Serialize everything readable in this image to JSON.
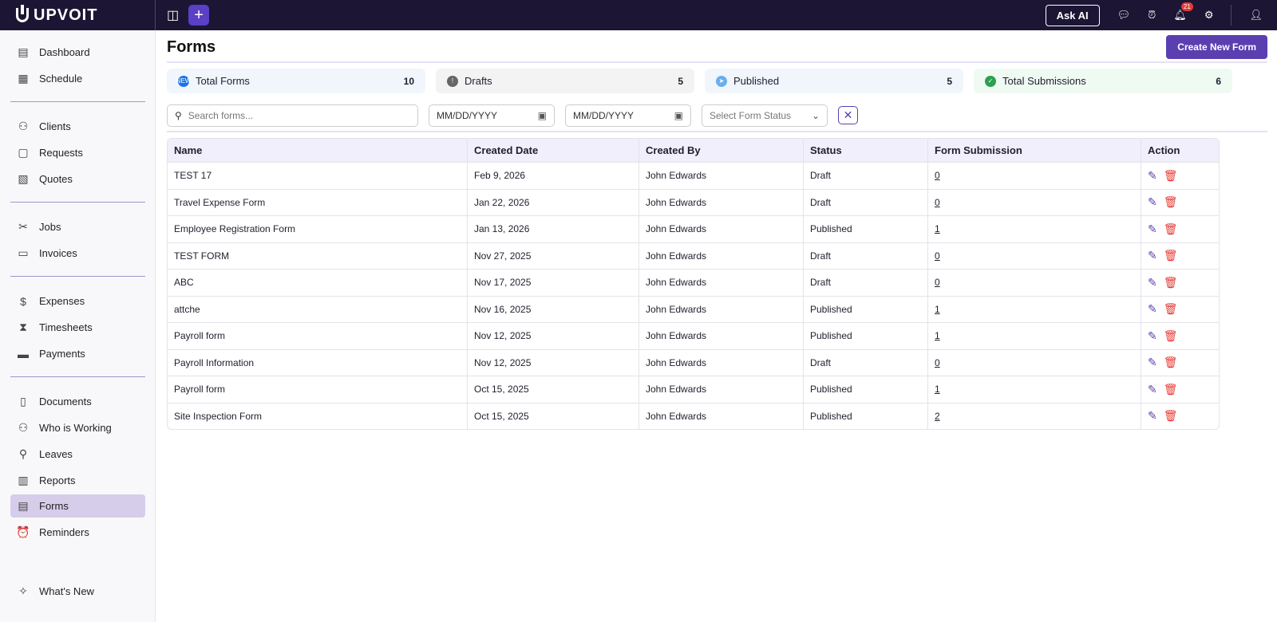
{
  "brand": "UPVOIT",
  "topbar": {
    "ask_ai": "Ask AI",
    "notifications": "21"
  },
  "sidebar": {
    "items": [
      {
        "label": "Dashboard",
        "icon": "▤"
      },
      {
        "label": "Schedule",
        "icon": "▦"
      },
      {
        "label": "Clients",
        "icon": "⚇"
      },
      {
        "label": "Requests",
        "icon": "▢"
      },
      {
        "label": "Quotes",
        "icon": "▧"
      },
      {
        "label": "Jobs",
        "icon": "✂"
      },
      {
        "label": "Invoices",
        "icon": "▭"
      },
      {
        "label": "Expenses",
        "icon": "$"
      },
      {
        "label": "Timesheets",
        "icon": "⧗"
      },
      {
        "label": "Payments",
        "icon": "▬"
      },
      {
        "label": "Documents",
        "icon": "▯"
      },
      {
        "label": "Who is Working",
        "icon": "⚇"
      },
      {
        "label": "Leaves",
        "icon": "⚲"
      },
      {
        "label": "Reports",
        "icon": "▥"
      },
      {
        "label": "Forms",
        "icon": "▤"
      },
      {
        "label": "Reminders",
        "icon": "⏰"
      },
      {
        "label": "What's New",
        "icon": "✧"
      }
    ],
    "active": "Forms"
  },
  "page": {
    "title": "Forms",
    "create_button": "Create New Form"
  },
  "stats": [
    {
      "label": "Total Forms",
      "value": "10",
      "icon_text": "NEW",
      "color": "#1a73e8",
      "bg": "#f1f6fd"
    },
    {
      "label": "Drafts",
      "value": "5",
      "icon_text": "!",
      "color": "#666666",
      "bg": "#f3f3f4"
    },
    {
      "label": "Published",
      "value": "5",
      "icon_text": "➤",
      "color": "#6aaef0",
      "bg": "#f1f6fd"
    },
    {
      "label": "Total Submissions",
      "value": "6",
      "icon_text": "✓",
      "color": "#2e9e4f",
      "bg": "#effaf3"
    }
  ],
  "filters": {
    "search_placeholder": "Search forms...",
    "start_date": "MM/DD/YYYY",
    "end_date": "MM/DD/YYYY",
    "status_placeholder": "Select Form Status"
  },
  "table": {
    "headers": [
      "Name",
      "Created Date",
      "Created By",
      "Status",
      "Form Submission",
      "Action"
    ],
    "rows": [
      [
        "TEST 17",
        "Feb 9, 2026",
        "John Edwards",
        "Draft",
        "0"
      ],
      [
        "Travel Expense Form",
        "Jan 22, 2026",
        "John Edwards",
        "Draft",
        "0"
      ],
      [
        "Employee Registration Form",
        "Jan 13, 2026",
        "John Edwards",
        "Published",
        "1"
      ],
      [
        "TEST FORM",
        "Nov 27, 2025",
        "John Edwards",
        "Draft",
        "0"
      ],
      [
        "ABC",
        "Nov 17, 2025",
        "John Edwards",
        "Draft",
        "0"
      ],
      [
        "attche",
        "Nov 16, 2025",
        "John Edwards",
        "Published",
        "1"
      ],
      [
        "Payroll form",
        "Nov 12, 2025",
        "John Edwards",
        "Published",
        "1"
      ],
      [
        "Payroll Information",
        "Nov 12, 2025",
        "John Edwards",
        "Draft",
        "0"
      ],
      [
        "Payroll form",
        "Oct 15, 2025",
        "John Edwards",
        "Published",
        "1"
      ],
      [
        "Site Inspection Form",
        "Oct 15, 2025",
        "John Edwards",
        "Published",
        "2"
      ]
    ]
  }
}
